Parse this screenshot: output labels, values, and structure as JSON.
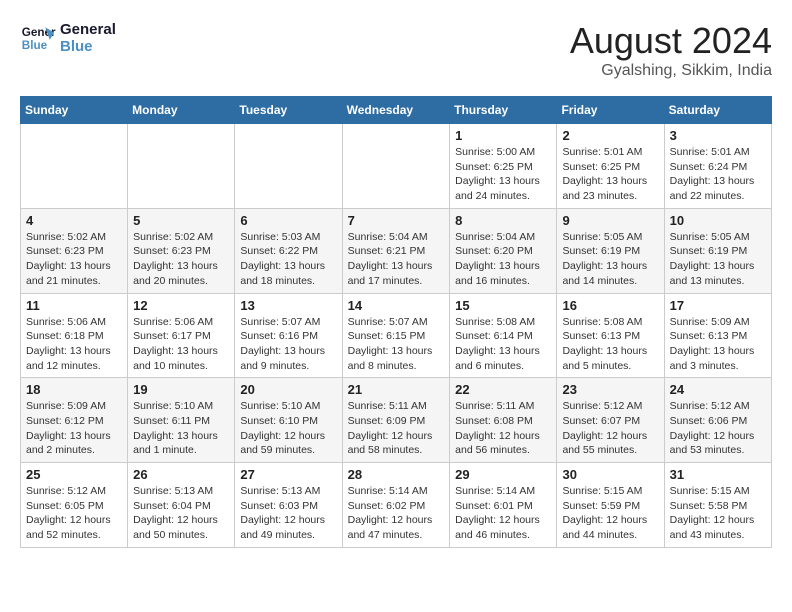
{
  "header": {
    "logo_line1": "General",
    "logo_line2": "Blue",
    "month_year": "August 2024",
    "location": "Gyalshing, Sikkim, India"
  },
  "weekdays": [
    "Sunday",
    "Monday",
    "Tuesday",
    "Wednesday",
    "Thursday",
    "Friday",
    "Saturday"
  ],
  "weeks": [
    [
      {
        "day": "",
        "info": ""
      },
      {
        "day": "",
        "info": ""
      },
      {
        "day": "",
        "info": ""
      },
      {
        "day": "",
        "info": ""
      },
      {
        "day": "1",
        "info": "Sunrise: 5:00 AM\nSunset: 6:25 PM\nDaylight: 13 hours and 24 minutes."
      },
      {
        "day": "2",
        "info": "Sunrise: 5:01 AM\nSunset: 6:25 PM\nDaylight: 13 hours and 23 minutes."
      },
      {
        "day": "3",
        "info": "Sunrise: 5:01 AM\nSunset: 6:24 PM\nDaylight: 13 hours and 22 minutes."
      }
    ],
    [
      {
        "day": "4",
        "info": "Sunrise: 5:02 AM\nSunset: 6:23 PM\nDaylight: 13 hours and 21 minutes."
      },
      {
        "day": "5",
        "info": "Sunrise: 5:02 AM\nSunset: 6:23 PM\nDaylight: 13 hours and 20 minutes."
      },
      {
        "day": "6",
        "info": "Sunrise: 5:03 AM\nSunset: 6:22 PM\nDaylight: 13 hours and 18 minutes."
      },
      {
        "day": "7",
        "info": "Sunrise: 5:04 AM\nSunset: 6:21 PM\nDaylight: 13 hours and 17 minutes."
      },
      {
        "day": "8",
        "info": "Sunrise: 5:04 AM\nSunset: 6:20 PM\nDaylight: 13 hours and 16 minutes."
      },
      {
        "day": "9",
        "info": "Sunrise: 5:05 AM\nSunset: 6:19 PM\nDaylight: 13 hours and 14 minutes."
      },
      {
        "day": "10",
        "info": "Sunrise: 5:05 AM\nSunset: 6:19 PM\nDaylight: 13 hours and 13 minutes."
      }
    ],
    [
      {
        "day": "11",
        "info": "Sunrise: 5:06 AM\nSunset: 6:18 PM\nDaylight: 13 hours and 12 minutes."
      },
      {
        "day": "12",
        "info": "Sunrise: 5:06 AM\nSunset: 6:17 PM\nDaylight: 13 hours and 10 minutes."
      },
      {
        "day": "13",
        "info": "Sunrise: 5:07 AM\nSunset: 6:16 PM\nDaylight: 13 hours and 9 minutes."
      },
      {
        "day": "14",
        "info": "Sunrise: 5:07 AM\nSunset: 6:15 PM\nDaylight: 13 hours and 8 minutes."
      },
      {
        "day": "15",
        "info": "Sunrise: 5:08 AM\nSunset: 6:14 PM\nDaylight: 13 hours and 6 minutes."
      },
      {
        "day": "16",
        "info": "Sunrise: 5:08 AM\nSunset: 6:13 PM\nDaylight: 13 hours and 5 minutes."
      },
      {
        "day": "17",
        "info": "Sunrise: 5:09 AM\nSunset: 6:13 PM\nDaylight: 13 hours and 3 minutes."
      }
    ],
    [
      {
        "day": "18",
        "info": "Sunrise: 5:09 AM\nSunset: 6:12 PM\nDaylight: 13 hours and 2 minutes."
      },
      {
        "day": "19",
        "info": "Sunrise: 5:10 AM\nSunset: 6:11 PM\nDaylight: 13 hours and 1 minute."
      },
      {
        "day": "20",
        "info": "Sunrise: 5:10 AM\nSunset: 6:10 PM\nDaylight: 12 hours and 59 minutes."
      },
      {
        "day": "21",
        "info": "Sunrise: 5:11 AM\nSunset: 6:09 PM\nDaylight: 12 hours and 58 minutes."
      },
      {
        "day": "22",
        "info": "Sunrise: 5:11 AM\nSunset: 6:08 PM\nDaylight: 12 hours and 56 minutes."
      },
      {
        "day": "23",
        "info": "Sunrise: 5:12 AM\nSunset: 6:07 PM\nDaylight: 12 hours and 55 minutes."
      },
      {
        "day": "24",
        "info": "Sunrise: 5:12 AM\nSunset: 6:06 PM\nDaylight: 12 hours and 53 minutes."
      }
    ],
    [
      {
        "day": "25",
        "info": "Sunrise: 5:12 AM\nSunset: 6:05 PM\nDaylight: 12 hours and 52 minutes."
      },
      {
        "day": "26",
        "info": "Sunrise: 5:13 AM\nSunset: 6:04 PM\nDaylight: 12 hours and 50 minutes."
      },
      {
        "day": "27",
        "info": "Sunrise: 5:13 AM\nSunset: 6:03 PM\nDaylight: 12 hours and 49 minutes."
      },
      {
        "day": "28",
        "info": "Sunrise: 5:14 AM\nSunset: 6:02 PM\nDaylight: 12 hours and 47 minutes."
      },
      {
        "day": "29",
        "info": "Sunrise: 5:14 AM\nSunset: 6:01 PM\nDaylight: 12 hours and 46 minutes."
      },
      {
        "day": "30",
        "info": "Sunrise: 5:15 AM\nSunset: 5:59 PM\nDaylight: 12 hours and 44 minutes."
      },
      {
        "day": "31",
        "info": "Sunrise: 5:15 AM\nSunset: 5:58 PM\nDaylight: 12 hours and 43 minutes."
      }
    ]
  ]
}
